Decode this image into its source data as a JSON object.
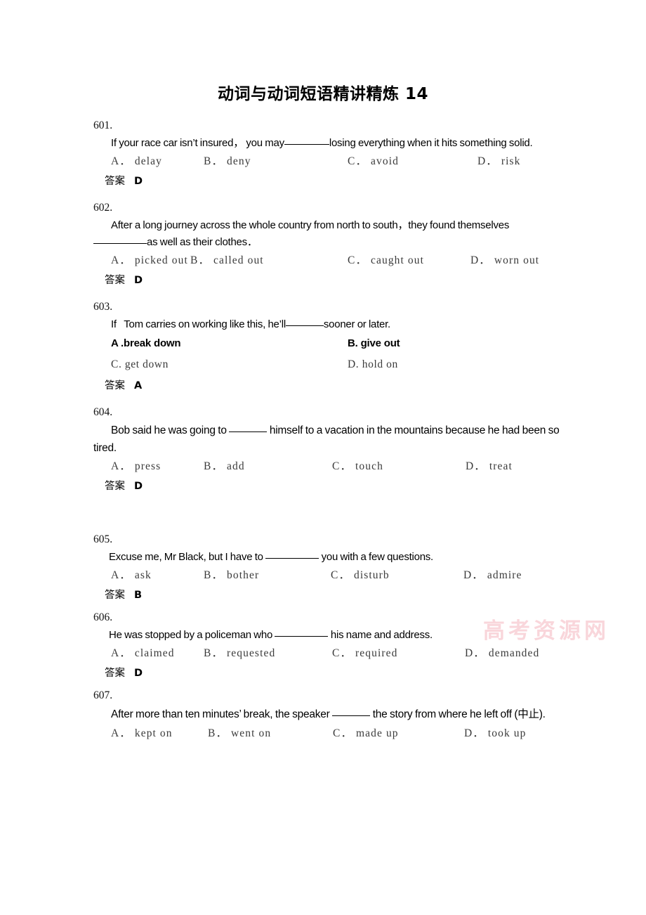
{
  "document": {
    "title": "动词与动词短语精讲精炼 14",
    "watermark": "高考资源网",
    "watermark_color": "#f7c9cf",
    "answer_label": "答案"
  },
  "questions": [
    {
      "number": "601.",
      "stem_pre": "If your race car isn’t insured， you may",
      "stem_post": "losing everything when it hits something solid.",
      "options": [
        "A． delay",
        "B． deny",
        "C． avoid",
        "D． risk"
      ],
      "answer": "D"
    },
    {
      "number": "602.",
      "stem_line1": "After a long journey across the whole country from north to south，they found themselves",
      "stem_line2_post": "as well as their clothes．",
      "options": [
        "A． picked out",
        "B． called out",
        "C． caught out",
        "D． worn out"
      ],
      "answer": "D"
    },
    {
      "number": "603.",
      "stem_pre": "If  Tom carries on working like this, he’ll",
      "stem_post": "sooner or later.",
      "option_a": "A .break down",
      "option_b": "B. give out",
      "option_c": "C. get down",
      "option_d": "D. hold on",
      "answer": "A"
    },
    {
      "number": "604.",
      "stem_pre": "Bob said he was going to",
      "stem_post": " himself to a vacation in the mountains because",
      "stem_line2": "he had been so tired.",
      "options": [
        "A． press",
        "B． add",
        "C． touch",
        "D． treat"
      ],
      "answer": "D"
    },
    {
      "number": "605.",
      "stem_pre": "Excuse me, Mr Black, but I have to",
      "stem_post": " you with a few questions.",
      "options": [
        "A． ask",
        "B． bother",
        "C． disturb",
        "D． admire"
      ],
      "answer": "B"
    },
    {
      "number": "606.",
      "stem_pre": "He was stopped by a policeman who",
      "stem_post": " his name and address.",
      "options": [
        "A． claimed",
        "B． requested",
        "C． required",
        "D． demanded"
      ],
      "answer": "D"
    },
    {
      "number": "607.",
      "stem_pre": "After more than ten minutes’ break, the speaker",
      "stem_post": " the story from where he left off (中",
      "stem_line2": "止).",
      "options": [
        "A． kept on",
        "B． went on",
        "C． made up",
        "D． took up"
      ]
    }
  ]
}
